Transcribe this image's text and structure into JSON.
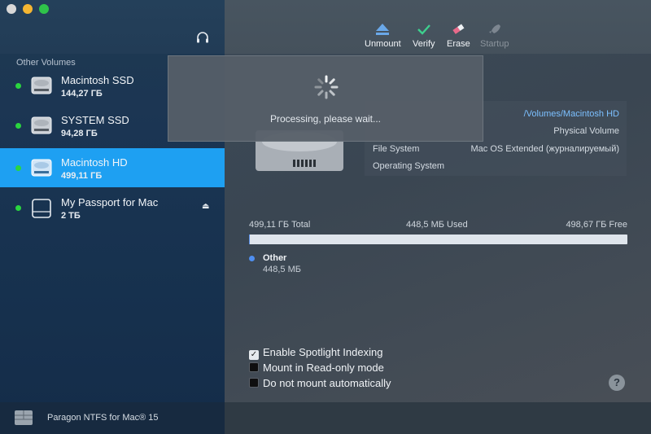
{
  "sidebar": {
    "section_label": "Other Volumes",
    "volumes": [
      {
        "name": "Macintosh SSD",
        "size": "144,27 ГБ",
        "mounted": true
      },
      {
        "name": "SYSTEM SSD",
        "size": "94,28 ГБ",
        "mounted": true
      },
      {
        "name": "Macintosh HD",
        "size": "499,11 ГБ",
        "mounted": true,
        "selected": true
      },
      {
        "name": "My Passport for Mac",
        "size": "2 ТБ",
        "mounted": true,
        "eject": "⏏"
      }
    ],
    "brand": "Paragon NTFS for Mac® 15"
  },
  "toolbar": {
    "unmount": "Unmount",
    "verify": "Verify",
    "erase": "Erase",
    "startup": "Startup"
  },
  "overlay": {
    "message": "Processing, please wait..."
  },
  "info": {
    "rows": [
      {
        "key": "",
        "value": "/Volumes/Macintosh HD"
      },
      {
        "key": "",
        "value": "Physical Volume"
      },
      {
        "key": "File System",
        "value": "Mac OS Extended (журналируемый)"
      },
      {
        "key": "Operating System",
        "value": ""
      }
    ]
  },
  "usage": {
    "total": "499,11 ГБ Total",
    "used": "448,5 МБ Used",
    "free": "498,67 ГБ Free",
    "used_fraction": 0.0009,
    "legend_name": "Other",
    "legend_size": "448,5 МБ"
  },
  "options": [
    {
      "label": "Enable Spotlight Indexing",
      "checked": true
    },
    {
      "label": "Mount in Read-only mode",
      "checked": false
    },
    {
      "label": "Do not mount automatically",
      "checked": false
    }
  ],
  "help": "?",
  "colors": {
    "selection": "#1ea0f2",
    "mounted_dot": "#2ad53f",
    "accent_link": "#7cc0ff",
    "verify_green": "#3ecf8e",
    "unmount_blue": "#6aa8e8",
    "erase_pink": "#e86a8a"
  }
}
